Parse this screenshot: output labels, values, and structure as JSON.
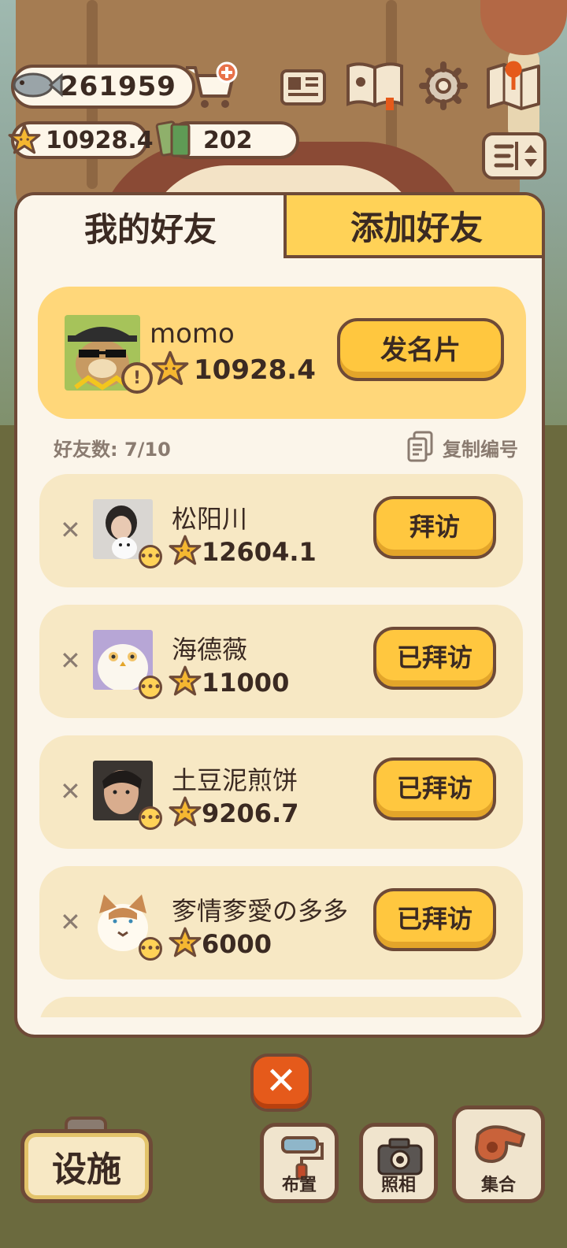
{
  "resources": {
    "fish": "261959",
    "stars": "10928.4",
    "tickets": "202"
  },
  "tabs": [
    {
      "label": "我的好友"
    },
    {
      "label": "添加好友"
    }
  ],
  "self": {
    "name": "momo",
    "score": "10928.4",
    "card_button": "发名片"
  },
  "meta": {
    "friend_count": "好友数: 7/10",
    "copy_label": "复制编号"
  },
  "friends": [
    {
      "name": "松阳川",
      "score": "12604.1",
      "action": "拜访"
    },
    {
      "name": "海德薇",
      "score": "11000",
      "action": "已拜访"
    },
    {
      "name": "土豆泥煎饼",
      "score": "9206.7",
      "action": "已拜访"
    },
    {
      "name": "奓情奓愛の多多",
      "score": "6000",
      "action": "已拜访"
    }
  ],
  "bottom": {
    "close": "✕",
    "facility": "设施",
    "layout": "布置",
    "photo": "照相",
    "gather": "集合"
  },
  "colors": {
    "accent_yellow": "#ffc73f",
    "outline_brown": "#6e4a37",
    "close_orange": "#e55a1b",
    "panel_cream": "#fbf5ea"
  },
  "icons": [
    "fish-icon",
    "cart-icon",
    "star-icon",
    "ticket-icon",
    "newspaper-icon",
    "book-icon",
    "gear-icon",
    "map-icon",
    "sort-icon",
    "copy-icon",
    "close-icon",
    "paint-roller-icon",
    "camera-icon",
    "whistle-icon"
  ]
}
